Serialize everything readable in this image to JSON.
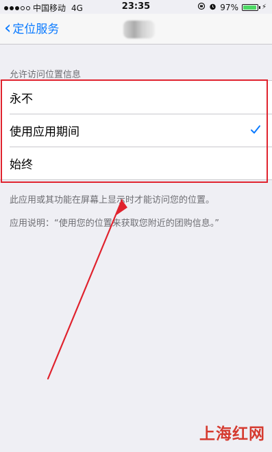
{
  "status_bar": {
    "carrier": "中国移动",
    "network": "4G",
    "time": "23:35",
    "battery_percent": "97%",
    "battery_level": 0.97
  },
  "nav": {
    "back_label": "定位服务"
  },
  "section_header": "允许访问位置信息",
  "options": [
    {
      "label": "永不",
      "selected": false
    },
    {
      "label": "使用应用期间",
      "selected": true
    },
    {
      "label": "始终",
      "selected": false
    }
  ],
  "notes": {
    "permission_note": "此应用或其功能在屏幕上显示时才能访问您的位置。",
    "app_description": "应用说明：“使用您的位置来获取您附近的团购信息。”"
  },
  "watermark": "上海红网",
  "colors": {
    "accent": "#0a7aff",
    "highlight": "#e0222d",
    "battery": "#4cd964"
  }
}
